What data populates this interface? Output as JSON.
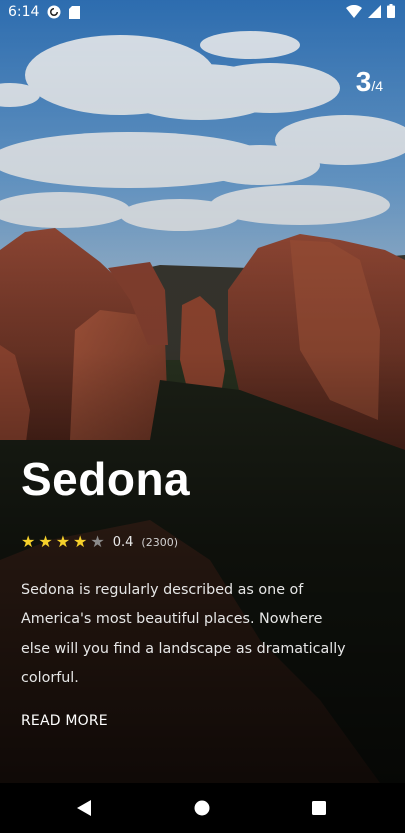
{
  "status_bar": {
    "time": "6:14",
    "left_icons": [
      "pocket-casts-icon",
      "sd-card-icon"
    ],
    "right_icons": [
      "wifi-icon",
      "cellular-signal-icon",
      "battery-icon"
    ]
  },
  "page_counter": {
    "current": "3",
    "total": "/4"
  },
  "place": {
    "title": "Sedona",
    "rating": {
      "stars_filled": 4,
      "stars_total": 5,
      "value": "0.4",
      "count": "(2300)"
    },
    "description": "Sedona is regularly described as one of America's most beautiful places. Nowhere else will you find a landscape as dramatically colorful.",
    "read_more_label": "READ MORE"
  },
  "nav_bar": {
    "buttons": [
      "back-triangle-icon",
      "home-circle-icon",
      "recents-square-icon"
    ]
  },
  "colors": {
    "star_filled": "#f5d02b",
    "star_empty": "#8a8a8a",
    "text_primary": "#ffffff"
  }
}
